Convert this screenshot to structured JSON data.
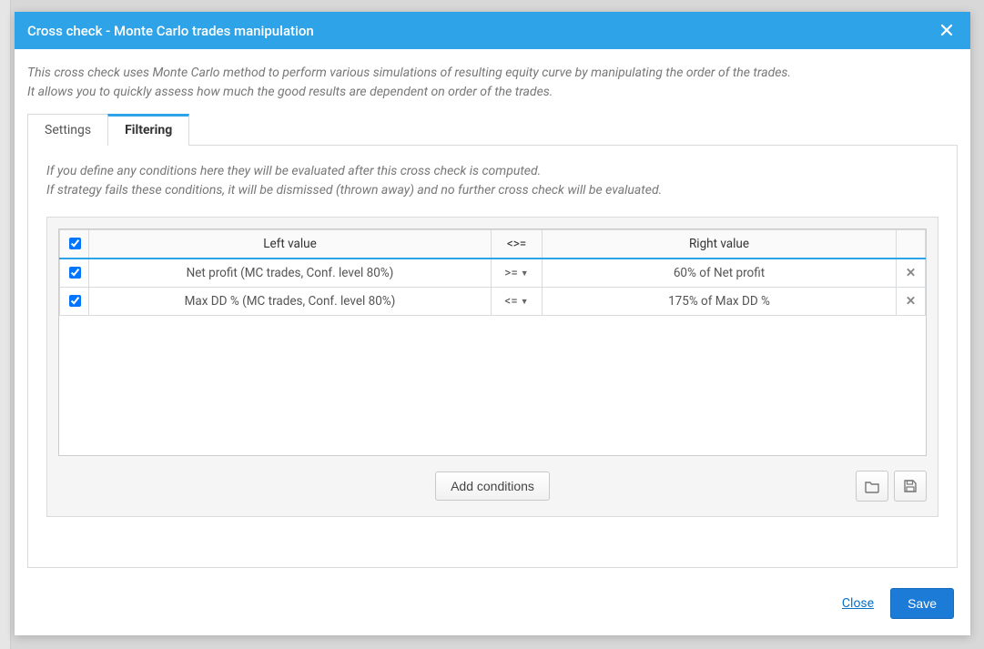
{
  "modal": {
    "title": "Cross check - Monte Carlo trades manipulation",
    "description_line1": "This cross check uses Monte Carlo method to perform various simulations of resulting equity curve by manipulating the order of the trades.",
    "description_line2": "It allows you to quickly assess how much the good results are dependent on order of the trades."
  },
  "tabs": {
    "settings": "Settings",
    "filtering": "Filtering"
  },
  "filtering": {
    "desc_line1": "If you define any conditions here they will be evaluated after this cross check is computed.",
    "desc_line2": "If strategy fails these conditions, it will be dismissed (thrown away) and no further cross check will be evaluated.",
    "headers": {
      "left": "Left value",
      "op": "<>=",
      "right": "Right value"
    },
    "rows": [
      {
        "checked": true,
        "left": "Net profit (MC trades, Conf. level 80%)",
        "op": ">=",
        "right": "60% of Net profit"
      },
      {
        "checked": true,
        "left": "Max DD % (MC trades, Conf. level 80%)",
        "op": "<=",
        "right": "175% of Max DD %"
      }
    ],
    "add_button": "Add conditions"
  },
  "footer": {
    "close": "Close",
    "save": "Save"
  }
}
